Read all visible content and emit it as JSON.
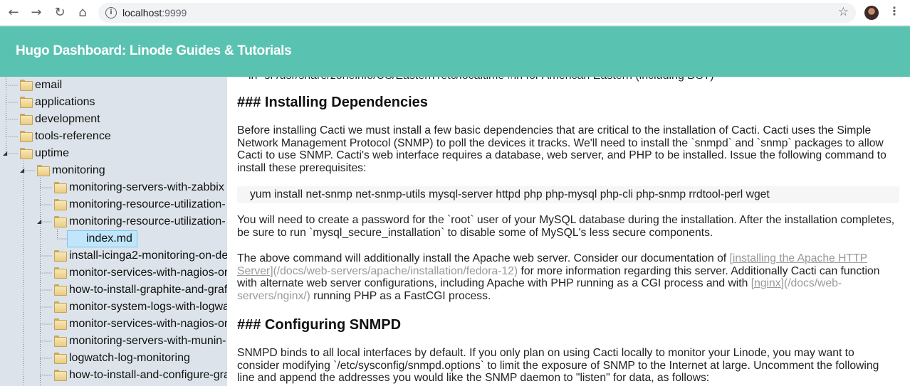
{
  "browser": {
    "url_host": "localhost",
    "url_port": ":9999"
  },
  "app": {
    "title": "Hugo Dashboard: Linode Guides & Tutorials"
  },
  "tree": [
    {
      "label": "email",
      "level": 0
    },
    {
      "label": "applications",
      "level": 0
    },
    {
      "label": "development",
      "level": 0
    },
    {
      "label": "tools-reference",
      "level": 0
    },
    {
      "label": "uptime",
      "level": 0,
      "expanded": true
    },
    {
      "label": "monitoring",
      "level": 1,
      "expanded": true
    },
    {
      "label": "monitoring-servers-with-zabbix",
      "level": 2
    },
    {
      "label": "monitoring-resource-utilization-",
      "level": 2
    },
    {
      "label": "monitoring-resource-utilization-",
      "level": 2,
      "expanded": true
    },
    {
      "label": "index.md",
      "level": 3,
      "selected": true
    },
    {
      "label": "install-icinga2-monitoring-on-de",
      "level": 2
    },
    {
      "label": "monitor-services-with-nagios-on",
      "level": 2
    },
    {
      "label": "how-to-install-graphite-and-graf",
      "level": 2
    },
    {
      "label": "monitor-system-logs-with-logwa",
      "level": 2
    },
    {
      "label": "monitor-services-with-nagios-on",
      "level": 2
    },
    {
      "label": "monitoring-servers-with-munin-",
      "level": 2
    },
    {
      "label": "logwatch-log-monitoring",
      "level": 2
    },
    {
      "label": "how-to-install-and-configure-gra",
      "level": 2
    }
  ],
  "content": {
    "clipped_line": "ln -sf /usr/share/zoneinfo/US/Eastern /etc/localtime #ln for American Eastern (including DST)",
    "heading1": "### Installing Dependencies",
    "para1": "Before installing Cacti we must install a few basic dependencies that are critical to the installation of Cacti. Cacti uses the Simple Network Management Protocol (SNMP) to poll the devices it tracks. We'll need to install the `snmpd` and `snmp` packages to allow Cacti to use SNMP. Cacti's web interface requires a database, web server, and PHP to be installed. Issue the following command to install these prerequisites:",
    "code1": "yum install net-snmp net-snmp-utils mysql-server httpd php php-mysql php-cli php-snmp rrdtool-perl wget",
    "para2": "You will need to create a password for the `root` user of your MySQL database during the installation. After the installation completes, be sure to run `mysql_secure_installation` to disable some of MySQL's less secure components.",
    "para3_a": "The above command will additionally install the Apache web server. Consider our documentation of ",
    "para3_link1": "[installing the Apache HTTP Server]",
    "para3_link1_url": "(/docs/web-servers/apache/installation/fedora-12)",
    "para3_b": " for more information regarding this server. Additionally Cacti can function with alternate web server configurations, including Apache with PHP running as a CGI process and with ",
    "para3_link2": "[nginx]",
    "para3_link2_url": "(/docs/web-servers/nginx/)",
    "para3_c": " running PHP as a FastCGI process.",
    "heading2": "### Configuring SNMPD",
    "para4": "SNMPD binds to all local interfaces by default. If you only plan on using Cacti locally to monitor your Linode, you may want to consider modifying `/etc/sysconfig/snmpd.options` to limit the exposure of SNMP to the Internet at large. Uncomment the following line and append the addresses you would like the SNMP daemon to \"listen\" for data, as follows:"
  }
}
